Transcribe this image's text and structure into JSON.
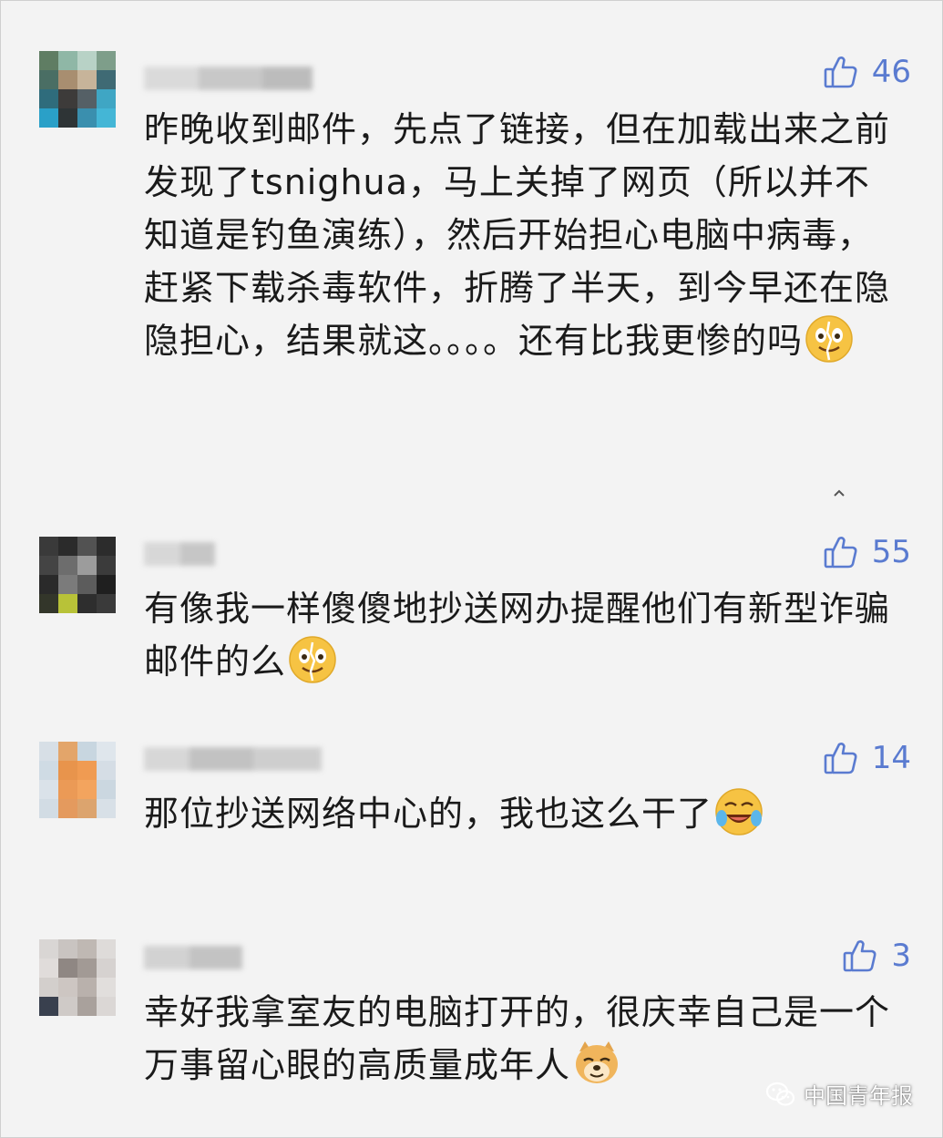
{
  "comments": [
    {
      "likes": "46",
      "text": "昨晚收到邮件，先点了链接，但在加载出来之前发现了tsnighua，马上关掉了网页（所以并不知道是钓鱼演练），然后开始担心电脑中病毒，赶紧下载杀毒软件，折腾了半天，到今早还在隐隐担心，结果就这。。。。还有比我更惨的吗",
      "emoji": "crying-smile-emoji"
    },
    {
      "likes": "55",
      "text": "有像我一样傻傻地抄送网办提醒他们有新型诈骗邮件的么",
      "emoji": "crying-smile-emoji"
    },
    {
      "likes": "14",
      "text": "那位抄送网络中心的，我也这么干了",
      "emoji": "laugh-cry-emoji"
    },
    {
      "likes": "3",
      "text": "幸好我拿室友的电脑打开的，很庆幸自己是一个万事留心眼的高质量成年人",
      "emoji": "doge-emoji"
    }
  ],
  "watermark": {
    "text": "中国青年报",
    "icon": "wechat-icon"
  },
  "colors": {
    "background": "#f3f3f3",
    "text": "#1a1a1a",
    "like": "#5a7bd0"
  }
}
